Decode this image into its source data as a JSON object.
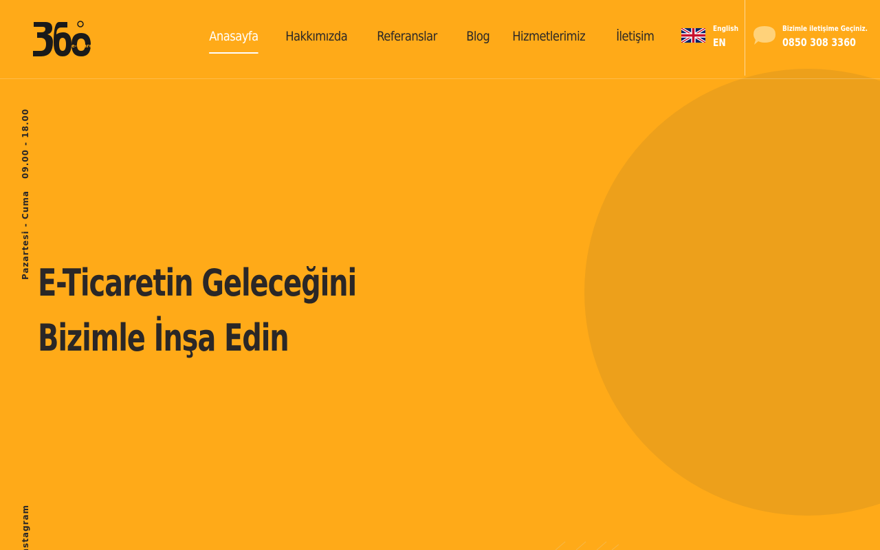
{
  "brand": {
    "logo_text": "360",
    "logo_sub": "e-ticaret"
  },
  "nav": {
    "items": [
      {
        "label": "Anasayfa",
        "active": true
      },
      {
        "label": "Hakkımızda",
        "active": false
      },
      {
        "label": "Referanslar",
        "active": false
      },
      {
        "label": "Blog",
        "active": false
      },
      {
        "label": "Hizmetlerimiz",
        "active": false
      },
      {
        "label": "İletişim",
        "active": false
      }
    ]
  },
  "language": {
    "name": "English",
    "code": "EN",
    "flag_icon": "uk-flag-icon"
  },
  "contact": {
    "label": "Bizimle iletişime Geçiniz.",
    "phone": "0850 308 3360",
    "icon": "chat-bubble-icon"
  },
  "side": {
    "hours": "09.00 - 18.00",
    "days": "Pazartesi - Cuma",
    "social": "Instagram"
  },
  "hero": {
    "line1": "E-Ticaretin Geleceğini",
    "line2": "Bizimle İnşa Edin"
  },
  "colors": {
    "background": "#FFAA18",
    "circle": "#EDA01B",
    "text_dark": "#2A2727",
    "text_light": "#FFFFFF"
  }
}
